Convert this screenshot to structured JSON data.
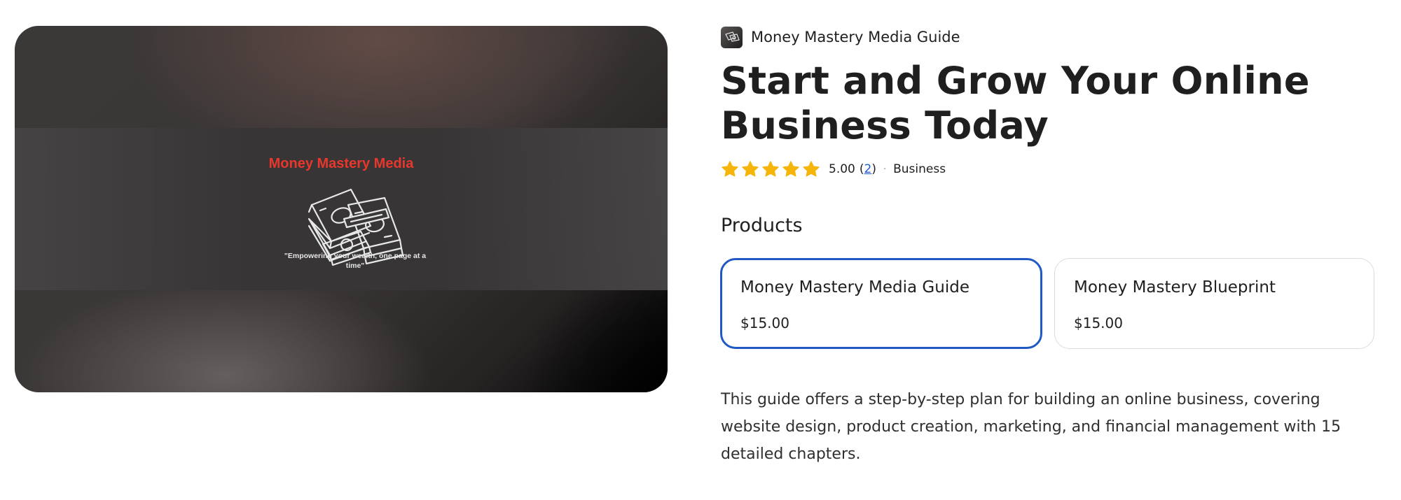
{
  "hero": {
    "brand_text": "Money Mastery Media",
    "tagline": "\"Empowering your wealth, one page at a time\""
  },
  "store": {
    "name": "Money Mastery Media Guide",
    "logo_icon": "money-stack-icon"
  },
  "product": {
    "title": "Start and Grow Your Online Business Today",
    "rating": {
      "stars": 5,
      "max_stars": 5,
      "value": "5.00",
      "open_paren": "(",
      "count": "2",
      "close_paren": ")",
      "star_color": "#f5b50a"
    },
    "separator": "·",
    "category": "Business",
    "description": "This guide offers a step-by-step plan for building an online business, covering website design, product creation, marketing, and financial management with 15 detailed chapters."
  },
  "products_section": {
    "heading": "Products",
    "items": [
      {
        "name": "Money Mastery Media Guide",
        "price": "$15.00",
        "selected": true
      },
      {
        "name": "Money Mastery Blueprint",
        "price": "$15.00",
        "selected": false
      }
    ]
  },
  "colors": {
    "accent_blue": "#2159c4",
    "brand_red": "#e8372c",
    "star_gold": "#f5b50a"
  }
}
